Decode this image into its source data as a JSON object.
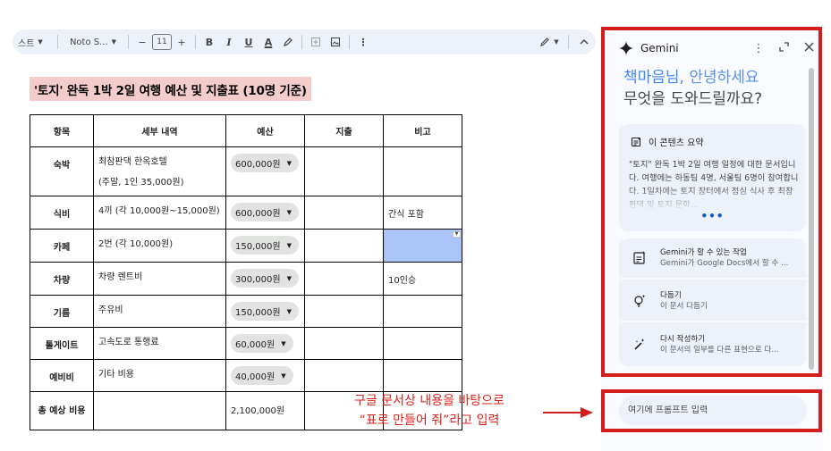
{
  "toolbar": {
    "style": "스트",
    "font": "Noto S...",
    "font_size": "11",
    "minus": "−",
    "plus": "+",
    "bold": "B",
    "italic": "I",
    "underline": "U",
    "text_color": "A",
    "more": "⋮"
  },
  "doc": {
    "title": "'토지' 완독 1박 2일 여행 예산 및 지출표 (10명 기준)",
    "headers": [
      "항목",
      "세부 내역",
      "예산",
      "지출",
      "비고"
    ],
    "rows": [
      {
        "category": "숙박",
        "detail_line1": "최참판댁 한옥호텔",
        "detail_line2": "(주말, 1인 35,000원)",
        "budget": "600,000원",
        "spend": "",
        "note": ""
      },
      {
        "category": "식비",
        "detail_line1": "4끼 (각 10,000원~15,000원)",
        "budget": "600,000원",
        "spend": "",
        "note": "간식 포함"
      },
      {
        "category": "카페",
        "detail_line1": "2번 (각 10,000원)",
        "budget": "150,000원",
        "spend": "",
        "note": ""
      },
      {
        "category": "차량",
        "detail_line1": "차량 렌트비",
        "budget": "300,000원",
        "spend": "",
        "note": "10인승"
      },
      {
        "category": "기름",
        "detail_line1": "주유비",
        "budget": "150,000원",
        "spend": "",
        "note": ""
      },
      {
        "category": "톨게이트",
        "detail_line1": "고속도로 통행료",
        "budget": "60,000원",
        "spend": "",
        "note": ""
      },
      {
        "category": "예비비",
        "detail_line1": "기타 비용",
        "budget": "40,000원",
        "spend": "",
        "note": ""
      }
    ],
    "total": {
      "category": "총 예상 비용",
      "detail": "",
      "budget": "2,100,000원"
    }
  },
  "annotation": {
    "line1": "구글 문서상 내용을 바탕으로",
    "line2": "“표로 만들어 줘”라고 입력"
  },
  "gemini": {
    "name": "Gemini",
    "greeting_name": "책마음님,",
    "greeting_hello": "안녕하세요",
    "greeting_question": "무엇을 도와드릴까요?",
    "summary_title": "이 콘텐츠 요약",
    "summary_text": "\"토지\" 완독 1박 2일 여행 일정에 대한 문서입니다. 여행에는 하동팀 4명, 서울팀 6명이 참여합니다. 1일차에는 토지 장터에서 점심 식사 후 최참판댁 및 토지 문학...",
    "summary_more": "•••",
    "actions": [
      {
        "title": "Gemini가 할 수 있는 작업",
        "sub": "Gemini가 Google Docs에서 할 수 ..."
      },
      {
        "title": "다듬기",
        "sub": "이 문서 다듬기"
      },
      {
        "title": "다시 작성하기",
        "sub": "이 문서의 일부를 다른 표현으로 다..."
      }
    ],
    "prompt_placeholder": "여기에 프롬프트 입력"
  },
  "colors": {
    "accent_blue": "#4285f4",
    "highlight_red": "#d51d1d",
    "title_bg": "#f4cccc",
    "selected_cell": "#aac4f7"
  }
}
